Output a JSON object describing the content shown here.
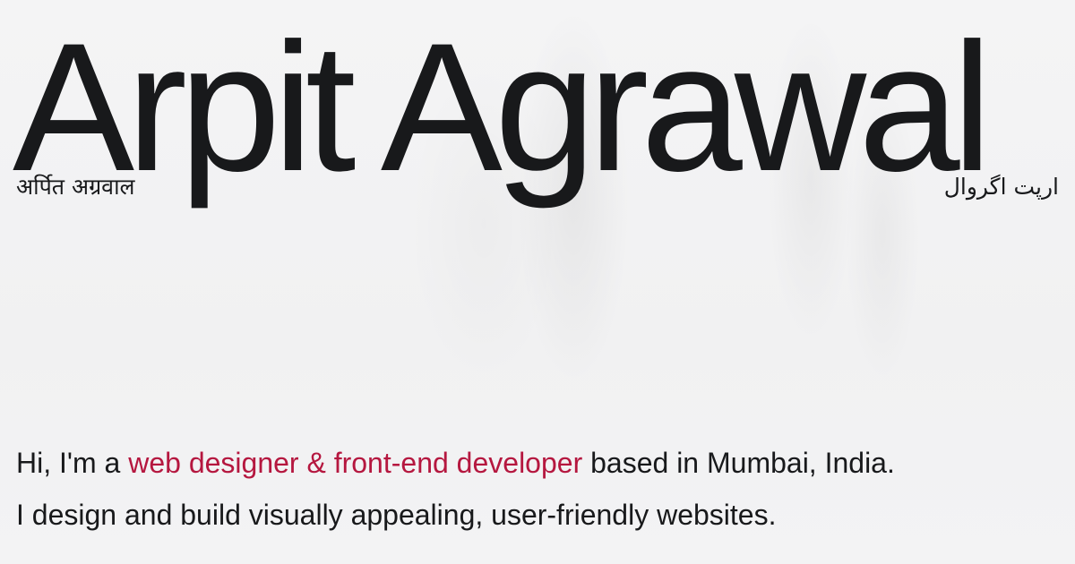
{
  "hero": {
    "name": "Arpit Agrawal",
    "name_hindi": "अर्पित अग्रवाल",
    "name_urdu": "ارپت اگروال"
  },
  "intro": {
    "line1_prefix": "Hi, I'm a ",
    "line1_highlight": "web designer & front-end developer",
    "line1_suffix": " based in Mumbai, India.",
    "line2": "I design and build visually appealing, user-friendly websites."
  },
  "colors": {
    "background": "#f2f2f3",
    "text": "#18191b",
    "accent": "#b5173f"
  }
}
